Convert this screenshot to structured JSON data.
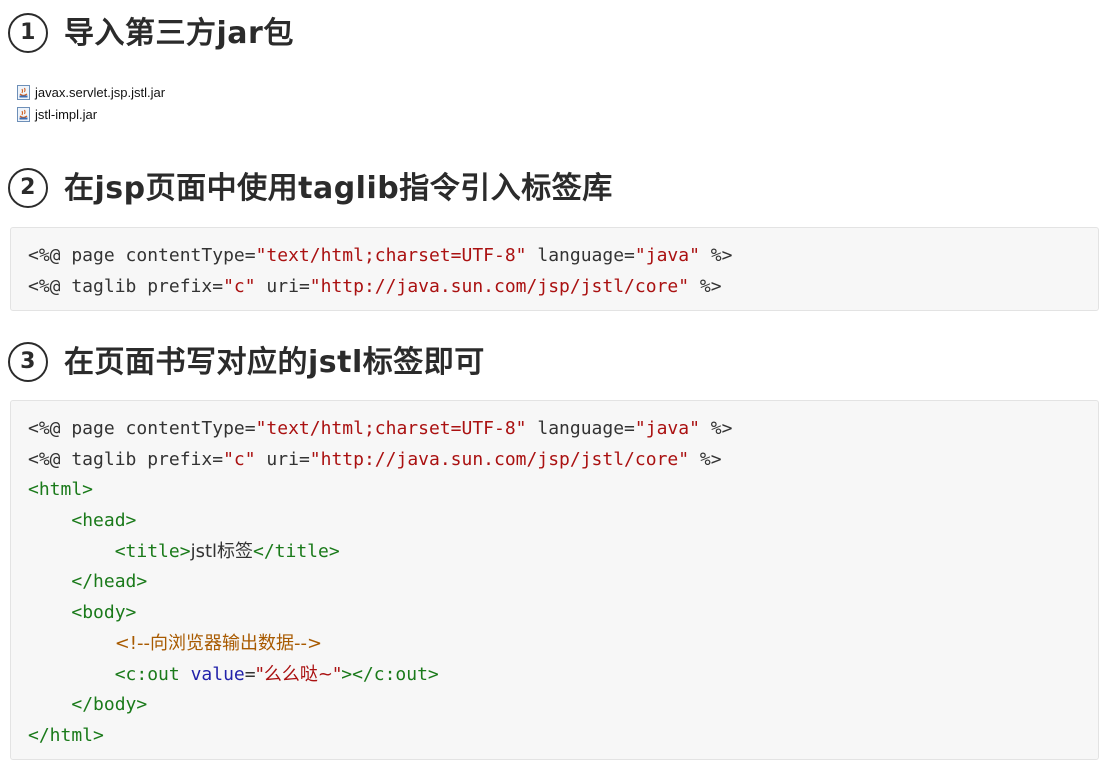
{
  "sections": [
    {
      "num": "1",
      "title": "导入第三方jar包"
    },
    {
      "num": "2",
      "title": "在jsp页面中使用taglib指令引入标签库"
    },
    {
      "num": "3",
      "title": "在页面书写对应的jstl标签即可"
    }
  ],
  "files": [
    {
      "name": "javax.servlet.jsp.jstl.jar",
      "icon": "jar-file-icon"
    },
    {
      "name": "jstl-impl.jar",
      "icon": "jar-file-icon"
    }
  ],
  "code_block_1": {
    "lines": [
      [
        [
          "t",
          "<%@ page contentType="
        ],
        [
          "s",
          "\"text/html;charset=UTF-8\""
        ],
        [
          "t",
          " language="
        ],
        [
          "s",
          "\"java\""
        ],
        [
          "t",
          " %>"
        ]
      ],
      [
        [
          "t",
          "<%@ taglib prefix="
        ],
        [
          "s",
          "\"c\""
        ],
        [
          "t",
          " uri="
        ],
        [
          "s",
          "\"http://java.sun.com/jsp/jstl/core\""
        ],
        [
          "t",
          " %>"
        ]
      ]
    ]
  },
  "code_block_2": {
    "lines": [
      [
        [
          "t",
          "<%@ page contentType="
        ],
        [
          "s",
          "\"text/html;charset=UTF-8\""
        ],
        [
          "t",
          " language="
        ],
        [
          "s",
          "\"java\""
        ],
        [
          "t",
          " %>"
        ]
      ],
      [
        [
          "t",
          "<%@ taglib prefix="
        ],
        [
          "s",
          "\"c\""
        ],
        [
          "t",
          " uri="
        ],
        [
          "s",
          "\"http://java.sun.com/jsp/jstl/core\""
        ],
        [
          "t",
          " %>"
        ]
      ],
      [
        [
          "g",
          "<html>"
        ]
      ],
      [
        [
          "t",
          "    "
        ],
        [
          "g",
          "<head>"
        ]
      ],
      [
        [
          "t",
          "        "
        ],
        [
          "g",
          "<title>"
        ],
        [
          "t",
          "jstl标签"
        ],
        [
          "g",
          "</title>"
        ]
      ],
      [
        [
          "t",
          "    "
        ],
        [
          "g",
          "</head>"
        ]
      ],
      [
        [
          "t",
          "    "
        ],
        [
          "g",
          "<body>"
        ]
      ],
      [
        [
          "t",
          "        "
        ],
        [
          "c",
          "<!--向浏览器输出数据-->"
        ]
      ],
      [
        [
          "t",
          "        "
        ],
        [
          "g",
          "<c:out "
        ],
        [
          "a",
          "value"
        ],
        [
          "t",
          "="
        ],
        [
          "s",
          "\"么么哒~\""
        ],
        [
          "g",
          "></c:out>"
        ]
      ],
      [
        [
          "t",
          "    "
        ],
        [
          "g",
          "</body>"
        ]
      ],
      [
        [
          "g",
          "</html>"
        ]
      ]
    ]
  },
  "colors": {
    "string": "#aa1111",
    "tag": "#1a7a1a",
    "comment": "#a85a00",
    "attribute": "#2222aa",
    "code_bg": "#f7f7f7"
  }
}
